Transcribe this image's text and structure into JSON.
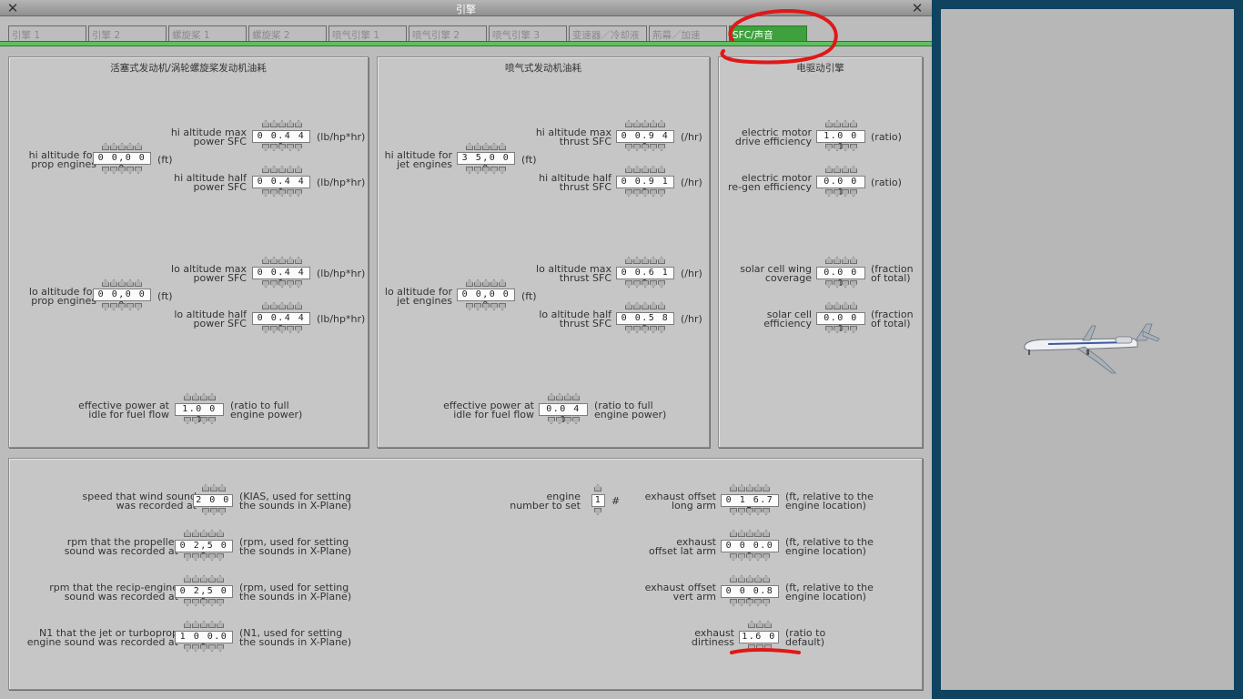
{
  "window": {
    "title": "引擎"
  },
  "tabs": [
    {
      "label": "引擎 1"
    },
    {
      "label": "引擎 2"
    },
    {
      "label": "螺旋桨 1"
    },
    {
      "label": "螺旋桨 2"
    },
    {
      "label": "喷气引擎 1"
    },
    {
      "label": "喷气引擎 2"
    },
    {
      "label": "喷气引擎 3"
    },
    {
      "label": "变速器／冷却液"
    },
    {
      "label": "荊幕／加速"
    },
    {
      "label": "SFC/声音",
      "active": true
    }
  ],
  "panels": {
    "prop": {
      "title": "活塞式发动机/涡轮螺旋桨发动机油耗",
      "hi_alt": {
        "label1": "hi altitude for",
        "label2": "prop engines",
        "value": "0 0,0 0 0",
        "unit": "(ft)"
      },
      "hi_max": {
        "label1": "hi altitude max",
        "label2": "power SFC",
        "value": "0 0.4 4 0",
        "unit": "(lb/hp*hr)"
      },
      "hi_half": {
        "label1": "hi altitude half",
        "label2": "power SFC",
        "value": "0 0.4 4 0",
        "unit": "(lb/hp*hr)"
      },
      "lo_alt": {
        "label1": "lo altitude for",
        "label2": "prop engines",
        "value": "0 0,0 0 0",
        "unit": "(ft)"
      },
      "lo_max": {
        "label1": "lo altitude max",
        "label2": "power SFC",
        "value": "0 0.4 4 0",
        "unit": "(lb/hp*hr)"
      },
      "lo_half": {
        "label1": "lo altitude half",
        "label2": "power SFC",
        "value": "0 0.4 4 0",
        "unit": "(lb/hp*hr)"
      },
      "idle": {
        "label1": "effective power at",
        "label2": "idle for fuel flow",
        "value": "1.0 0 0",
        "unit1": "(ratio to full",
        "unit2": "engine power)"
      }
    },
    "jet": {
      "title": "喷气式发动机油耗",
      "hi_alt": {
        "label1": "hi altitude for",
        "label2": "jet engines",
        "value": "3 5,0 0 0",
        "unit": "(ft)"
      },
      "hi_max": {
        "label1": "hi altitude max",
        "label2": "thrust SFC",
        "value": "0 0.9 4 0",
        "unit": "(/hr)"
      },
      "hi_half": {
        "label1": "hi altitude half",
        "label2": "thrust SFC",
        "value": "0 0.9 1 0",
        "unit": "(/hr)"
      },
      "lo_alt": {
        "label1": "lo altitude for",
        "label2": "jet engines",
        "value": "0 0,0 0 0",
        "unit": "(ft)"
      },
      "lo_max": {
        "label1": "lo altitude max",
        "label2": "thrust SFC",
        "value": "0 0.6 1 0",
        "unit": "(/hr)"
      },
      "lo_half": {
        "label1": "lo altitude half",
        "label2": "thrust SFC",
        "value": "0 0.5 8 0",
        "unit": "(/hr)"
      },
      "idle": {
        "label1": "effective power at",
        "label2": "idle for fuel flow",
        "value": "0.0 4 0",
        "unit1": "(ratio to full",
        "unit2": "engine power)"
      }
    },
    "electric": {
      "title": "电驱动引擎",
      "drive": {
        "label1": "electric motor",
        "label2": "drive efficiency",
        "value": "1.0 0 0",
        "unit": "(ratio)"
      },
      "regen": {
        "label1": "electric motor",
        "label2": "re-gen efficiency",
        "value": "0.0 0 0",
        "unit": "(ratio)"
      },
      "wing": {
        "label1": "solar cell wing",
        "label2": "coverage",
        "value": "0.0 0 0",
        "unit1": "(fraction",
        "unit2": "of total)"
      },
      "eff": {
        "label1": "solar cell",
        "label2": "efficiency",
        "value": "0.0 0 0",
        "unit1": "(fraction",
        "unit2": "of total)"
      }
    },
    "sound": {
      "wind": {
        "label1": "speed that wind sound",
        "label2": "was recorded at",
        "value": "2 0 0",
        "unit1": "(KIAS, used for setting",
        "unit2": "the sounds in X-Plane)"
      },
      "prop_rpm": {
        "label1": "rpm that the propeller",
        "label2": "sound was recorded at",
        "value": "0 2,5 0 0",
        "unit1": "(rpm, used for setting",
        "unit2": "the sounds in X-Plane)"
      },
      "recip_rpm": {
        "label1": "rpm that the recip-engine",
        "label2": "sound was recorded at",
        "value": "0 2,5 0 0",
        "unit1": "(rpm, used for setting",
        "unit2": "the sounds in X-Plane)"
      },
      "n1": {
        "label1": "N1 that the jet or turboprop",
        "label2": "engine sound was recorded at",
        "value": "1 0 0.0 0",
        "unit1": "(N1, used for setting",
        "unit2": "the sounds in X-Plane)"
      },
      "engine_num": {
        "label1": "engine",
        "label2": "number to set",
        "value": "1",
        "unit": "#"
      },
      "ex_long": {
        "label1": "exhaust offset",
        "label2": "long arm",
        "value": "0 1 6.7 5",
        "unit1": "(ft, relative to the",
        "unit2": "engine location)"
      },
      "ex_lat": {
        "label1": "exhaust",
        "label2": "offset lat arm",
        "value": "0 0 0.0 0",
        "unit1": "(ft, relative to the",
        "unit2": "engine location)"
      },
      "ex_vert": {
        "label1": "exhaust offset",
        "label2": "vert arm",
        "value": "0 0 0.8 0",
        "unit1": "(ft, relative to the",
        "unit2": "engine location)"
      },
      "dirt": {
        "label1": "exhaust",
        "label2": "dirtiness",
        "value": "1.6 0",
        "unit1": "(ratio to",
        "unit2": "default)"
      }
    }
  },
  "colors": {
    "active_tab": "#3ea13e",
    "annotation": "#e01818",
    "preview_frame": "#0f4360"
  },
  "icons": {
    "close": "close-icon",
    "spinner_up": "arrow-up-icon",
    "spinner_down": "arrow-down-icon"
  }
}
